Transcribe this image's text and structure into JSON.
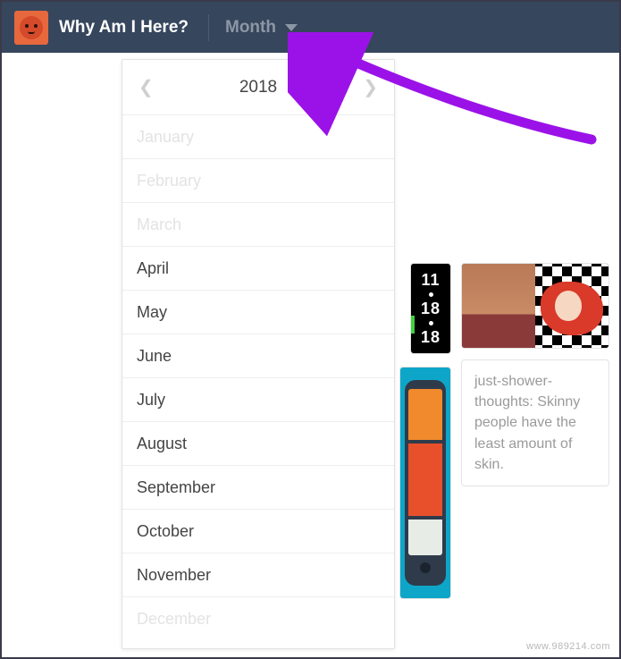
{
  "header": {
    "blog_title": "Why Am I Here?",
    "month_dropdown_label": "Month"
  },
  "year_picker": {
    "year": "2018",
    "months": [
      {
        "label": "January",
        "enabled": false
      },
      {
        "label": "February",
        "enabled": false
      },
      {
        "label": "March",
        "enabled": false
      },
      {
        "label": "April",
        "enabled": true
      },
      {
        "label": "May",
        "enabled": true
      },
      {
        "label": "June",
        "enabled": true
      },
      {
        "label": "July",
        "enabled": true
      },
      {
        "label": "August",
        "enabled": true
      },
      {
        "label": "September",
        "enabled": true
      },
      {
        "label": "October",
        "enabled": true
      },
      {
        "label": "November",
        "enabled": true
      },
      {
        "label": "December",
        "enabled": false
      }
    ]
  },
  "posts": {
    "date_card": {
      "day": "11",
      "month": "18",
      "year": "18"
    },
    "text_card": "just-shower-thoughts: Skinny people have the least amount of skin."
  },
  "watermark": "www.989214.com",
  "colors": {
    "header_bg": "#36465d",
    "accent_arrow": "#9b12e8"
  }
}
